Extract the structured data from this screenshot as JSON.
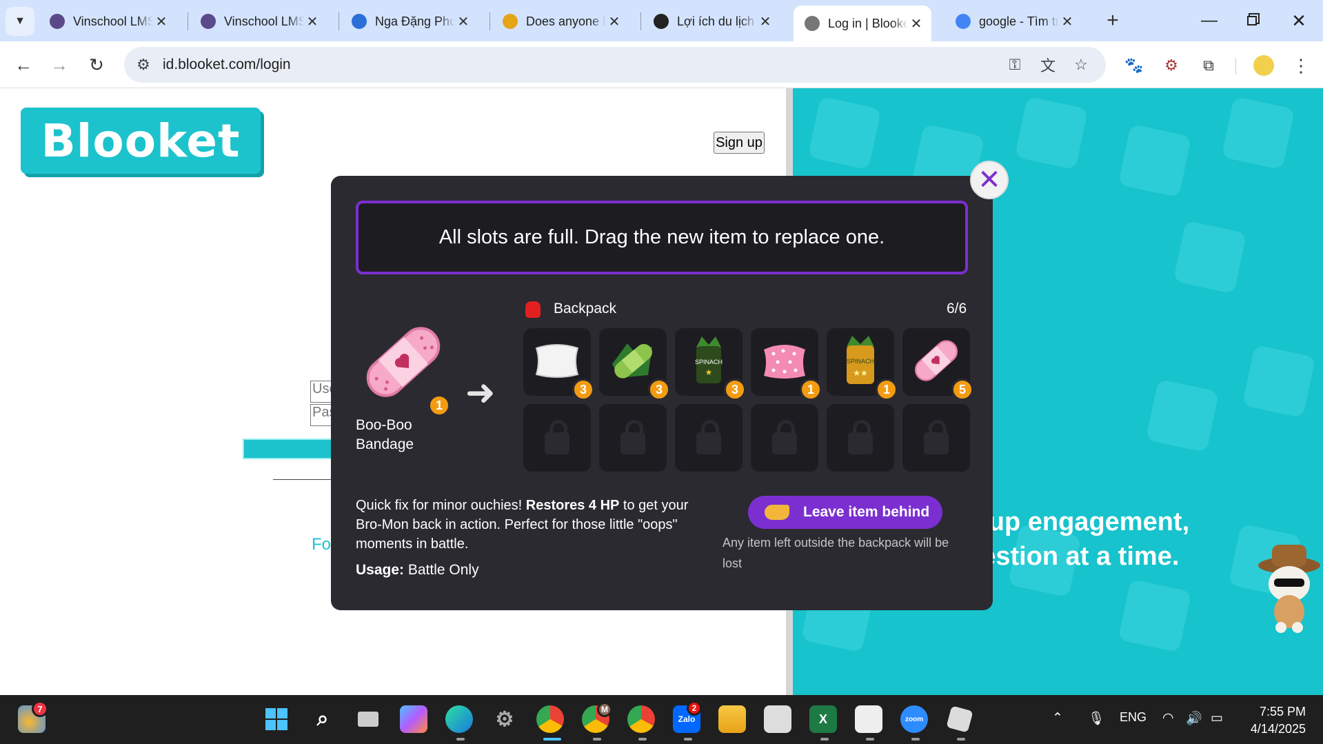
{
  "browser": {
    "tabs": [
      {
        "title": "Vinschool LMS",
        "favicon": "vinschool-icon",
        "color": "#5a4a8a"
      },
      {
        "title": "Vinschool LMS",
        "favicon": "vinschool-icon",
        "color": "#5a4a8a"
      },
      {
        "title": "Nga Đặng Phương",
        "favicon": "profile-icon",
        "color": "#2b6fd6"
      },
      {
        "title": "Does anyone know",
        "favicon": "chat-icon",
        "color": "#e6a417"
      },
      {
        "title": "Lợi ích du lịch",
        "favicon": "openai-icon",
        "color": "#222222"
      },
      {
        "title": "Log in | Blooket",
        "favicon": "globe-icon",
        "color": "#777777"
      },
      {
        "title": "google - Tìm trên Google",
        "favicon": "google-icon",
        "color": "#4285f4"
      }
    ],
    "url": "id.blooket.com/login"
  },
  "page": {
    "logo_text": "Blooket",
    "signup_label": "Sign up",
    "username_placeholder": "Username",
    "password_placeholder": "Password",
    "forgot_text": "Fo",
    "promo_line1": "g up engagement,",
    "promo_line2": "uestion at a time."
  },
  "modal": {
    "banner": "All slots are full. Drag the new item to replace one.",
    "backpack_label": "Backpack",
    "backpack_count": "6/6",
    "new_item": {
      "name_line1": "Boo-Boo",
      "name_line2": "Bandage",
      "count": "1"
    },
    "slots": [
      {
        "item": "pillow-icon",
        "count": "3"
      },
      {
        "item": "herb-bandage-icon",
        "count": "3"
      },
      {
        "item": "spinach-can-icon",
        "count": "3"
      },
      {
        "item": "polka-pillow-icon",
        "count": "1"
      },
      {
        "item": "golden-spinach-can-icon",
        "count": "1"
      },
      {
        "item": "boo-boo-bandage-icon",
        "count": "5"
      }
    ],
    "desc_prefix": "Quick fix for minor ouchies! ",
    "desc_bold": "Restores 4 HP",
    "desc_suffix": " to get your Bro-Mon back in action. Perfect for those little \"oops\" moments in battle.",
    "usage_label": "Usage:",
    "usage_value": " Battle Only",
    "leave_button": "Leave item behind",
    "leave_note": "Any item left outside the backpack will be lost",
    "accent": "#7b2fd0"
  },
  "taskbar": {
    "weather_badge": "7",
    "zalo_badge": "2",
    "chrome_m_badge": "M",
    "language": "ENG",
    "time": "7:55 PM",
    "date": "4/14/2025"
  }
}
